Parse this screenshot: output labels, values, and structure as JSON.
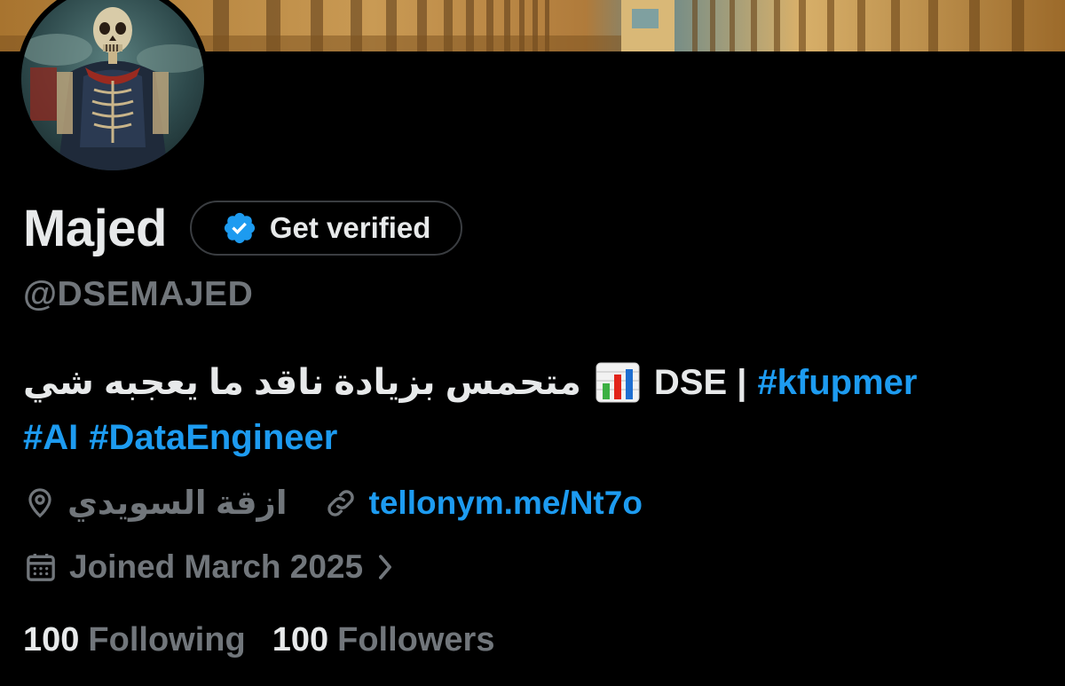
{
  "profile": {
    "display_name": "Majed",
    "handle": "@DSEMAJED",
    "verify_label": "Get verified"
  },
  "bio": {
    "arabic_text": "متحمس بزيادة ناقد ما يعجبه شي",
    "emoji_icon": "bar-chart-emoji",
    "dse_text": "DSE |",
    "hashtags_line1": [
      "#kfupmer"
    ],
    "hashtags_line2": [
      "#AI",
      "#DataEngineer"
    ]
  },
  "meta": {
    "location": "ازقة السويدي",
    "location_icon": "map-pin-icon",
    "link": "tellonym.me/Nt7o",
    "link_icon": "link-icon",
    "joined": "Joined March 2025",
    "joined_icon": "calendar-icon",
    "joined_chevron_icon": "chevron-right-icon"
  },
  "stats": {
    "following_count": "100",
    "following_label": "Following",
    "followers_count": "100",
    "followers_label": "Followers"
  },
  "colors": {
    "background": "#000000",
    "primary_text": "#e7e9ea",
    "secondary_text": "#71767b",
    "accent": "#1d9bf0",
    "verify_border": "#3a3d41"
  }
}
